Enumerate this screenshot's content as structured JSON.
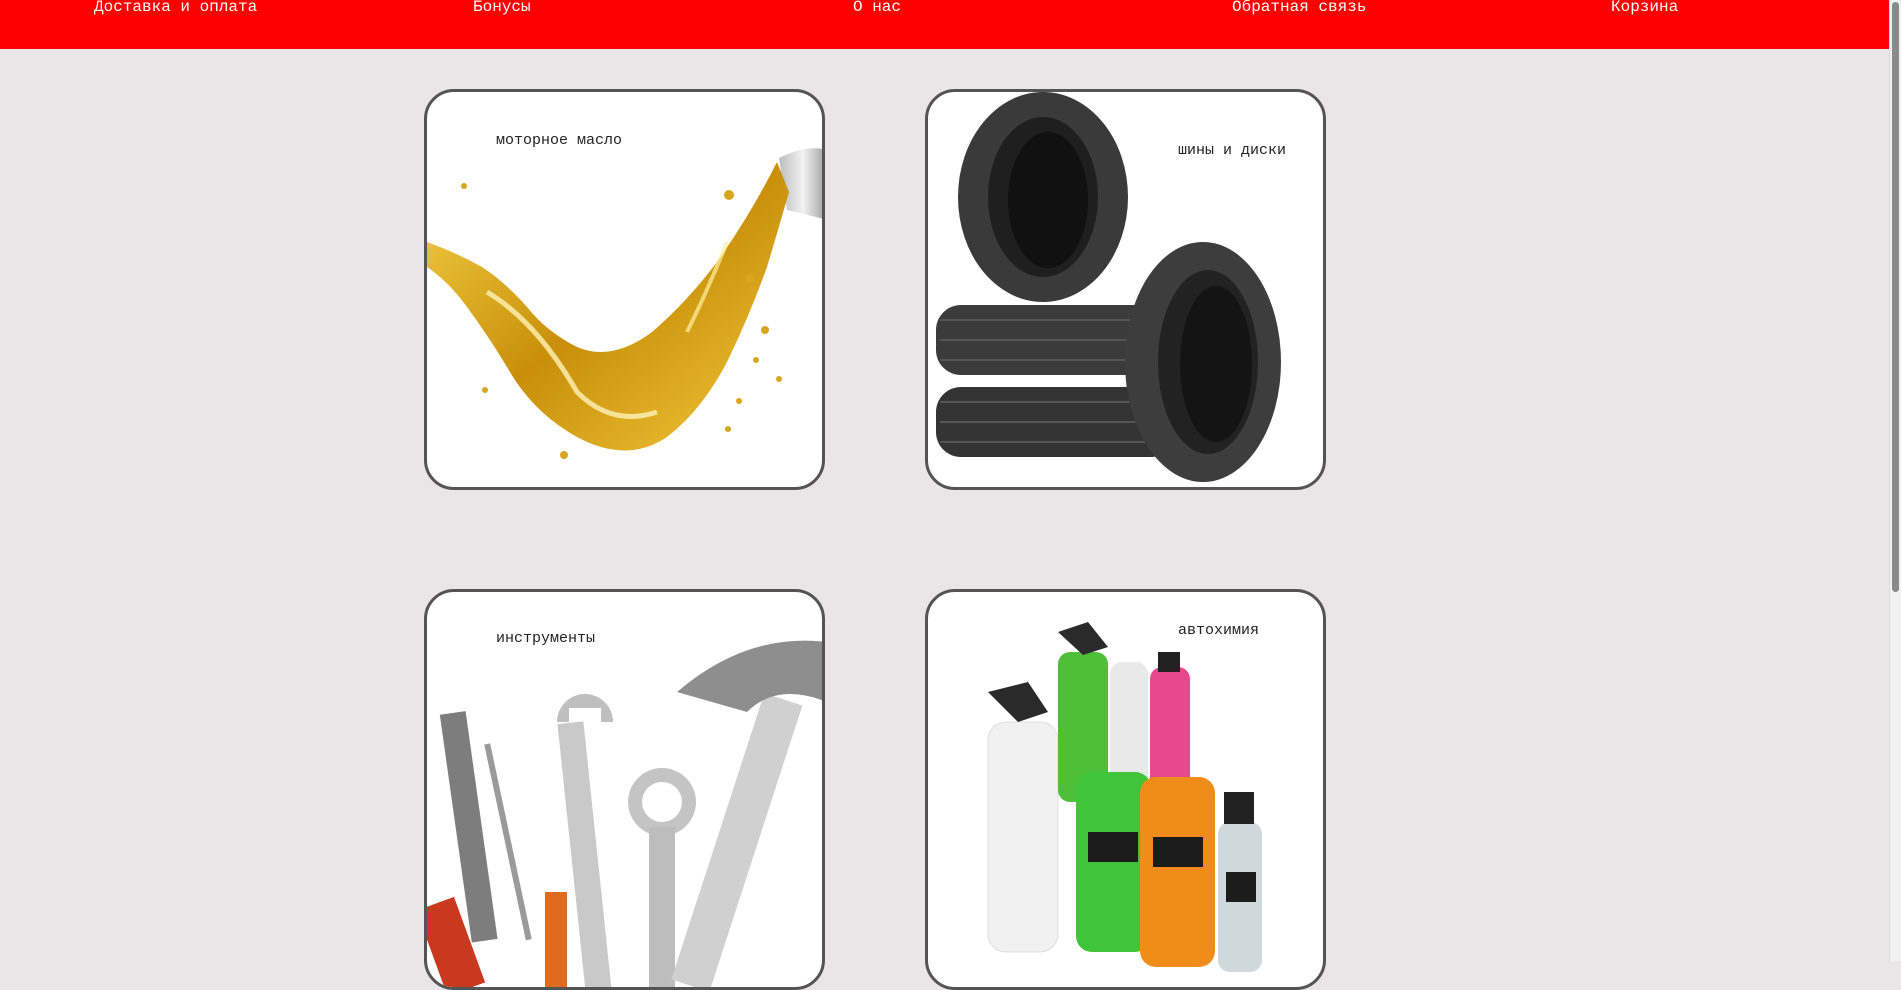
{
  "nav": {
    "items": [
      {
        "label": "Доставка и оплата"
      },
      {
        "label": "Бонусы"
      },
      {
        "label": "О нас"
      },
      {
        "label": "Обратная связь"
      },
      {
        "label": "Корзина"
      }
    ],
    "background": "#ff0000",
    "text_color": "#ffffff"
  },
  "page": {
    "background": "#e8e6e6"
  },
  "categories": [
    {
      "label": "моторное масло",
      "icon": "oil-splash-icon"
    },
    {
      "label": "шины и диски",
      "icon": "tires-icon"
    },
    {
      "label": "инструменты",
      "icon": "tools-icon"
    },
    {
      "label": "автохимия",
      "icon": "car-chemicals-icon"
    }
  ]
}
